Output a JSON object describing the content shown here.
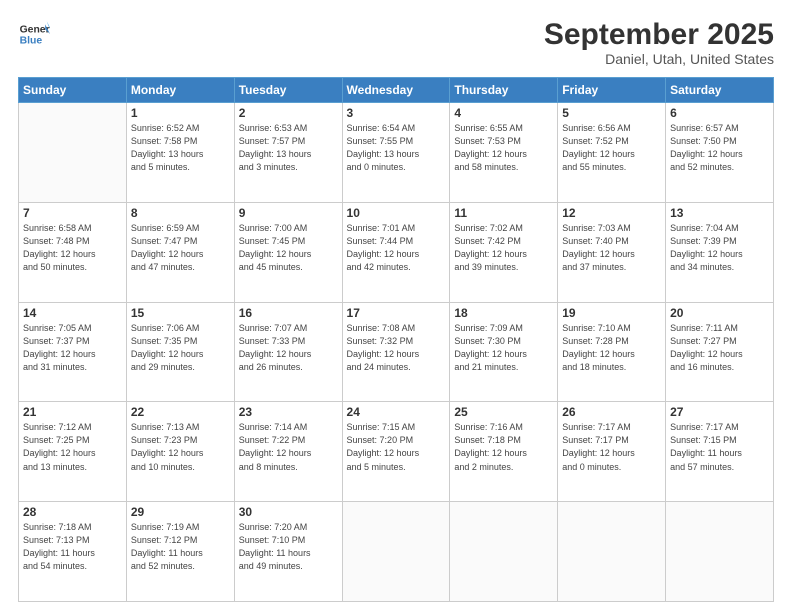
{
  "header": {
    "logo_line1": "General",
    "logo_line2": "Blue",
    "month": "September 2025",
    "location": "Daniel, Utah, United States"
  },
  "weekdays": [
    "Sunday",
    "Monday",
    "Tuesday",
    "Wednesday",
    "Thursday",
    "Friday",
    "Saturday"
  ],
  "weeks": [
    [
      {
        "day": "",
        "info": ""
      },
      {
        "day": "1",
        "info": "Sunrise: 6:52 AM\nSunset: 7:58 PM\nDaylight: 13 hours\nand 5 minutes."
      },
      {
        "day": "2",
        "info": "Sunrise: 6:53 AM\nSunset: 7:57 PM\nDaylight: 13 hours\nand 3 minutes."
      },
      {
        "day": "3",
        "info": "Sunrise: 6:54 AM\nSunset: 7:55 PM\nDaylight: 13 hours\nand 0 minutes."
      },
      {
        "day": "4",
        "info": "Sunrise: 6:55 AM\nSunset: 7:53 PM\nDaylight: 12 hours\nand 58 minutes."
      },
      {
        "day": "5",
        "info": "Sunrise: 6:56 AM\nSunset: 7:52 PM\nDaylight: 12 hours\nand 55 minutes."
      },
      {
        "day": "6",
        "info": "Sunrise: 6:57 AM\nSunset: 7:50 PM\nDaylight: 12 hours\nand 52 minutes."
      }
    ],
    [
      {
        "day": "7",
        "info": "Sunrise: 6:58 AM\nSunset: 7:48 PM\nDaylight: 12 hours\nand 50 minutes."
      },
      {
        "day": "8",
        "info": "Sunrise: 6:59 AM\nSunset: 7:47 PM\nDaylight: 12 hours\nand 47 minutes."
      },
      {
        "day": "9",
        "info": "Sunrise: 7:00 AM\nSunset: 7:45 PM\nDaylight: 12 hours\nand 45 minutes."
      },
      {
        "day": "10",
        "info": "Sunrise: 7:01 AM\nSunset: 7:44 PM\nDaylight: 12 hours\nand 42 minutes."
      },
      {
        "day": "11",
        "info": "Sunrise: 7:02 AM\nSunset: 7:42 PM\nDaylight: 12 hours\nand 39 minutes."
      },
      {
        "day": "12",
        "info": "Sunrise: 7:03 AM\nSunset: 7:40 PM\nDaylight: 12 hours\nand 37 minutes."
      },
      {
        "day": "13",
        "info": "Sunrise: 7:04 AM\nSunset: 7:39 PM\nDaylight: 12 hours\nand 34 minutes."
      }
    ],
    [
      {
        "day": "14",
        "info": "Sunrise: 7:05 AM\nSunset: 7:37 PM\nDaylight: 12 hours\nand 31 minutes."
      },
      {
        "day": "15",
        "info": "Sunrise: 7:06 AM\nSunset: 7:35 PM\nDaylight: 12 hours\nand 29 minutes."
      },
      {
        "day": "16",
        "info": "Sunrise: 7:07 AM\nSunset: 7:33 PM\nDaylight: 12 hours\nand 26 minutes."
      },
      {
        "day": "17",
        "info": "Sunrise: 7:08 AM\nSunset: 7:32 PM\nDaylight: 12 hours\nand 24 minutes."
      },
      {
        "day": "18",
        "info": "Sunrise: 7:09 AM\nSunset: 7:30 PM\nDaylight: 12 hours\nand 21 minutes."
      },
      {
        "day": "19",
        "info": "Sunrise: 7:10 AM\nSunset: 7:28 PM\nDaylight: 12 hours\nand 18 minutes."
      },
      {
        "day": "20",
        "info": "Sunrise: 7:11 AM\nSunset: 7:27 PM\nDaylight: 12 hours\nand 16 minutes."
      }
    ],
    [
      {
        "day": "21",
        "info": "Sunrise: 7:12 AM\nSunset: 7:25 PM\nDaylight: 12 hours\nand 13 minutes."
      },
      {
        "day": "22",
        "info": "Sunrise: 7:13 AM\nSunset: 7:23 PM\nDaylight: 12 hours\nand 10 minutes."
      },
      {
        "day": "23",
        "info": "Sunrise: 7:14 AM\nSunset: 7:22 PM\nDaylight: 12 hours\nand 8 minutes."
      },
      {
        "day": "24",
        "info": "Sunrise: 7:15 AM\nSunset: 7:20 PM\nDaylight: 12 hours\nand 5 minutes."
      },
      {
        "day": "25",
        "info": "Sunrise: 7:16 AM\nSunset: 7:18 PM\nDaylight: 12 hours\nand 2 minutes."
      },
      {
        "day": "26",
        "info": "Sunrise: 7:17 AM\nSunset: 7:17 PM\nDaylight: 12 hours\nand 0 minutes."
      },
      {
        "day": "27",
        "info": "Sunrise: 7:17 AM\nSunset: 7:15 PM\nDaylight: 11 hours\nand 57 minutes."
      }
    ],
    [
      {
        "day": "28",
        "info": "Sunrise: 7:18 AM\nSunset: 7:13 PM\nDaylight: 11 hours\nand 54 minutes."
      },
      {
        "day": "29",
        "info": "Sunrise: 7:19 AM\nSunset: 7:12 PM\nDaylight: 11 hours\nand 52 minutes."
      },
      {
        "day": "30",
        "info": "Sunrise: 7:20 AM\nSunset: 7:10 PM\nDaylight: 11 hours\nand 49 minutes."
      },
      {
        "day": "",
        "info": ""
      },
      {
        "day": "",
        "info": ""
      },
      {
        "day": "",
        "info": ""
      },
      {
        "day": "",
        "info": ""
      }
    ]
  ]
}
